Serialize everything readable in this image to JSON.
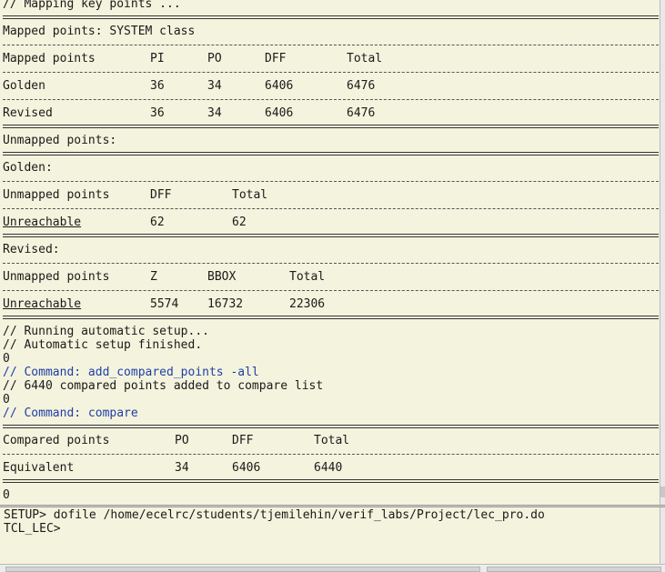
{
  "output": {
    "mapping_header": "// Mapping key points ...",
    "mapped_title": "Mapped points: SYSTEM class",
    "mapped_table": {
      "headers": [
        "Mapped points",
        "PI",
        "PO",
        "DFF",
        "Total"
      ],
      "golden": [
        "Golden",
        "36",
        "34",
        "6406",
        "6476"
      ],
      "revised": [
        "Revised",
        "36",
        "34",
        "6406",
        "6476"
      ]
    },
    "unmapped_title": "Unmapped points:",
    "golden_label": "Golden:",
    "golden_unmapped": {
      "headers": [
        "Unmapped points",
        "DFF",
        "Total"
      ],
      "row": [
        "Unreachable",
        "62",
        "62"
      ]
    },
    "revised_label": "Revised:",
    "revised_unmapped": {
      "headers": [
        "Unmapped points",
        "Z",
        "BBOX",
        "Total"
      ],
      "row": [
        "Unreachable",
        "5574",
        "16732",
        "22306"
      ]
    },
    "setup_lines": [
      "// Running automatic setup...",
      "// Automatic setup finished.",
      "0"
    ],
    "cmd_add": "// Command: add_compared_points -all",
    "add_result": "// 6440 compared points added to compare list",
    "add_return": "0",
    "cmd_compare": "// Command: compare",
    "compared_table": {
      "headers": [
        "Compared points",
        "PO",
        "DFF",
        "Total"
      ],
      "row": [
        "Equivalent",
        "34",
        "6406",
        "6440"
      ]
    },
    "final_return": "0"
  },
  "console": {
    "command_line": "SETUP> dofile /home/ecelrc/students/tjemilehin/verif_labs/Project/lec_pro.do",
    "prompt": "TCL_LEC>"
  },
  "colors": {
    "background": "#f4f3dd",
    "command_text": "#1f3fa8",
    "text": "#1a1a1a"
  }
}
